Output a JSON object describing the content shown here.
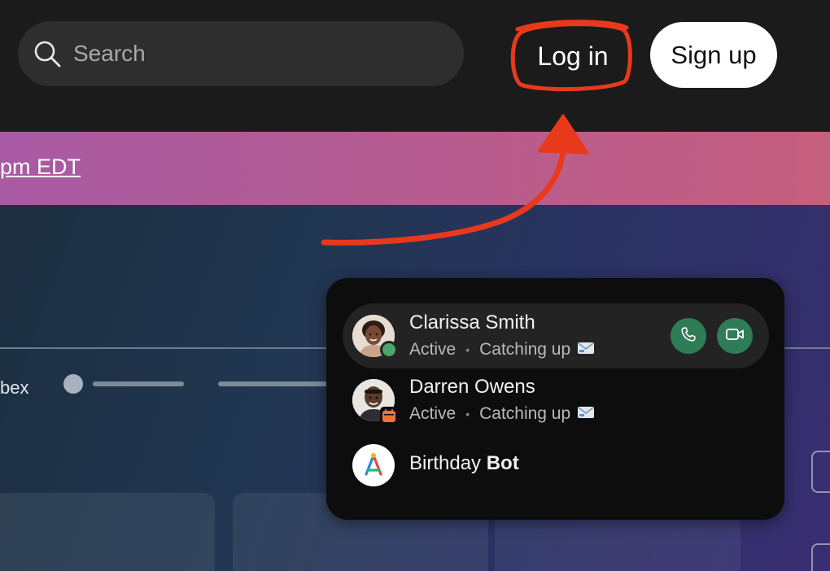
{
  "header": {
    "search": {
      "placeholder": "Search",
      "icon": "search-icon"
    },
    "login_label": "Log in",
    "signup_label": "Sign up"
  },
  "banner": {
    "link_text": "pm EDT"
  },
  "hero": {
    "partial_text": "bex"
  },
  "contacts": [
    {
      "name": "Clarissa Smith",
      "presence": "Active",
      "activity": "Catching up",
      "status_color": "#4aa66a",
      "selected": true
    },
    {
      "name": "Darren Owens",
      "presence": "Active",
      "activity": "Catching up",
      "badge": "calendar-icon"
    }
  ],
  "bot": {
    "name_prefix": "Birthday ",
    "name_bold": "Bot"
  },
  "colors": {
    "banner_start": "#a85aa3",
    "banner_end": "#c65e7e",
    "call_button": "#2e7d57",
    "annotation": "#e8391c"
  }
}
